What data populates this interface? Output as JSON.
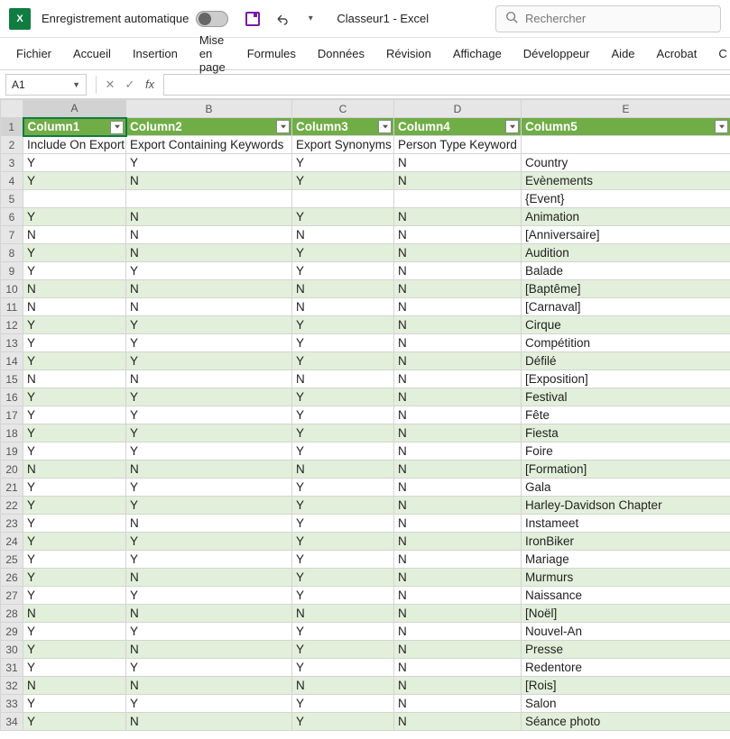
{
  "titleBar": {
    "autosave": "Enregistrement automatique",
    "fileTitle": "Classeur1 - Excel",
    "searchPlaceholder": "Rechercher"
  },
  "ribbon": {
    "tabs": [
      "Fichier",
      "Accueil",
      "Insertion",
      "Mise en page",
      "Formules",
      "Données",
      "Révision",
      "Affichage",
      "Développeur",
      "Aide",
      "Acrobat",
      "C"
    ]
  },
  "nameBox": "A1",
  "columns": [
    "A",
    "B",
    "C",
    "D",
    "E"
  ],
  "tableHeaders": [
    "Column1",
    "Column2",
    "Column3",
    "Column4",
    "Column5"
  ],
  "rows": [
    {
      "n": 1,
      "header": true
    },
    {
      "n": 2,
      "d": [
        "Include On Export",
        "Export Containing Keywords",
        "Export Synonyms",
        "Person Type Keyword",
        ""
      ]
    },
    {
      "n": 3,
      "d": [
        "Y",
        "Y",
        "Y",
        "N",
        "Country"
      ]
    },
    {
      "n": 4,
      "d": [
        "Y",
        "N",
        "Y",
        "N",
        "Evènements"
      ]
    },
    {
      "n": 5,
      "d": [
        "",
        "",
        "",
        "",
        "{Event}"
      ]
    },
    {
      "n": 6,
      "d": [
        "Y",
        "N",
        "Y",
        "N",
        "Animation"
      ]
    },
    {
      "n": 7,
      "d": [
        "N",
        "N",
        "N",
        "N",
        "[Anniversaire]"
      ]
    },
    {
      "n": 8,
      "d": [
        "Y",
        "N",
        "Y",
        "N",
        "Audition"
      ]
    },
    {
      "n": 9,
      "d": [
        "Y",
        "Y",
        "Y",
        "N",
        "Balade"
      ]
    },
    {
      "n": 10,
      "d": [
        "N",
        "N",
        "N",
        "N",
        "[Baptême]"
      ]
    },
    {
      "n": 11,
      "d": [
        "N",
        "N",
        "N",
        "N",
        "[Carnaval]"
      ]
    },
    {
      "n": 12,
      "d": [
        "Y",
        "Y",
        "Y",
        "N",
        "Cirque"
      ]
    },
    {
      "n": 13,
      "d": [
        "Y",
        "Y",
        "Y",
        "N",
        "Compétition"
      ]
    },
    {
      "n": 14,
      "d": [
        "Y",
        "Y",
        "Y",
        "N",
        "Défilé"
      ]
    },
    {
      "n": 15,
      "d": [
        "N",
        "N",
        "N",
        "N",
        "[Exposition]"
      ]
    },
    {
      "n": 16,
      "d": [
        "Y",
        "Y",
        "Y",
        "N",
        "Festival"
      ]
    },
    {
      "n": 17,
      "d": [
        "Y",
        "Y",
        "Y",
        "N",
        "Fête"
      ]
    },
    {
      "n": 18,
      "d": [
        "Y",
        "Y",
        "Y",
        "N",
        "Fiesta"
      ]
    },
    {
      "n": 19,
      "d": [
        "Y",
        "Y",
        "Y",
        "N",
        "Foire"
      ]
    },
    {
      "n": 20,
      "d": [
        "N",
        "N",
        "N",
        "N",
        "[Formation]"
      ]
    },
    {
      "n": 21,
      "d": [
        "Y",
        "Y",
        "Y",
        "N",
        "Gala"
      ]
    },
    {
      "n": 22,
      "d": [
        "Y",
        "Y",
        "Y",
        "N",
        "Harley-Davidson Chapter"
      ]
    },
    {
      "n": 23,
      "d": [
        "Y",
        "N",
        "Y",
        "N",
        "Instameet"
      ]
    },
    {
      "n": 24,
      "d": [
        "Y",
        "Y",
        "Y",
        "N",
        "IronBiker"
      ]
    },
    {
      "n": 25,
      "d": [
        "Y",
        "Y",
        "Y",
        "N",
        "Mariage"
      ]
    },
    {
      "n": 26,
      "d": [
        "Y",
        "N",
        "Y",
        "N",
        "Murmurs"
      ]
    },
    {
      "n": 27,
      "d": [
        "Y",
        "Y",
        "Y",
        "N",
        "Naissance"
      ]
    },
    {
      "n": 28,
      "d": [
        "N",
        "N",
        "N",
        "N",
        "[Noël]"
      ]
    },
    {
      "n": 29,
      "d": [
        "Y",
        "Y",
        "Y",
        "N",
        "Nouvel-An"
      ]
    },
    {
      "n": 30,
      "d": [
        "Y",
        "N",
        "Y",
        "N",
        "Presse"
      ]
    },
    {
      "n": 31,
      "d": [
        "Y",
        "Y",
        "Y",
        "N",
        "Redentore"
      ]
    },
    {
      "n": 32,
      "d": [
        "N",
        "N",
        "N",
        "N",
        "[Rois]"
      ]
    },
    {
      "n": 33,
      "d": [
        "Y",
        "Y",
        "Y",
        "N",
        "Salon"
      ]
    },
    {
      "n": 34,
      "d": [
        "Y",
        "N",
        "Y",
        "N",
        "Séance photo"
      ]
    }
  ]
}
